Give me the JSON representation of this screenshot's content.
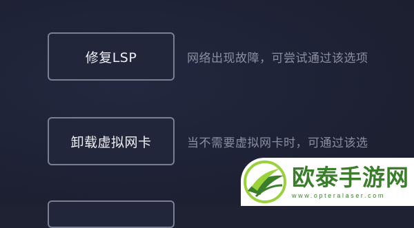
{
  "options": [
    {
      "button_label": "修复LSP",
      "description": "网络出现故障，可尝试通过该选项"
    },
    {
      "button_label": "卸载虚拟网卡",
      "description": "当不需要虚拟网卡时，可通过该选"
    }
  ],
  "watermark": {
    "title": "欧泰手游网",
    "url": "www.opteralaser.com",
    "logo_icon": "leaf-ring-logo",
    "brand_color": "#3a7d2a"
  },
  "colors": {
    "background": "#1e2233",
    "button_border": "#7a8094",
    "button_text": "#f0f1f5",
    "description_text": "#8a8fa0"
  }
}
